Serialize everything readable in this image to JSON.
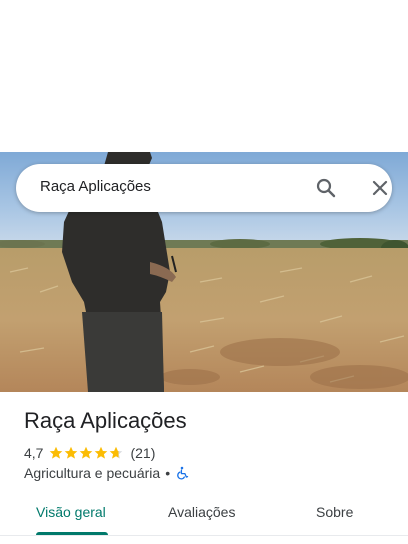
{
  "search": {
    "query": "Raça Aplicações",
    "search_icon": "search-icon",
    "close_icon": "close-icon"
  },
  "photo": {
    "subject": "field-photo"
  },
  "place": {
    "name": "Raça Aplicações",
    "rating": "4,7",
    "rating_stars": 4.7,
    "review_count": "(21)",
    "category": "Agricultura e pecuária",
    "separator": "•",
    "accessibility_icon": "wheelchair-icon"
  },
  "tabs": [
    {
      "label": "Visão geral",
      "active": true
    },
    {
      "label": "Avaliações",
      "active": false
    },
    {
      "label": "Sobre",
      "active": false
    }
  ],
  "colors": {
    "accent": "#00796b",
    "star": "#fbbc04",
    "accessibility": "#1a73e8"
  }
}
